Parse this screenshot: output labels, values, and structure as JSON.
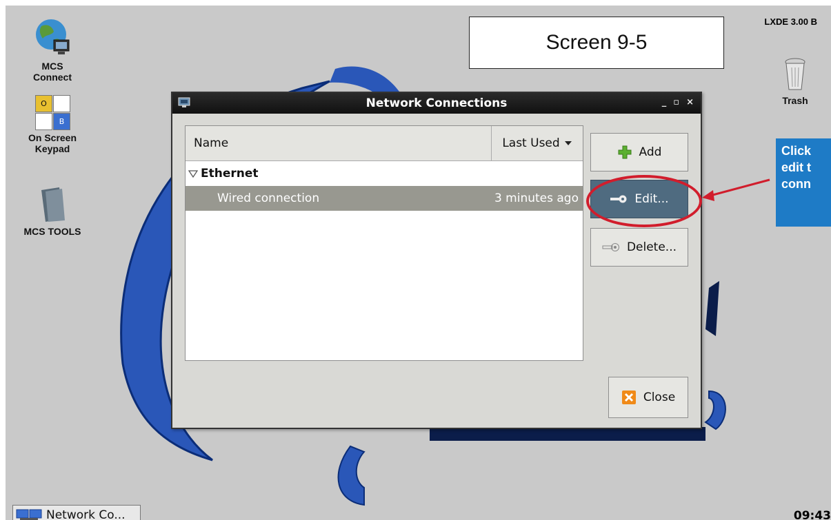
{
  "desktop": {
    "version": "LXDE 3.00 B",
    "icons": [
      {
        "label_line1": "MCS",
        "label_line2": "Connect"
      },
      {
        "label_line1": "On Screen",
        "label_line2": "Keypad"
      },
      {
        "label_line1": "MCS TOOLS"
      },
      {
        "label_line1": "Trash"
      }
    ],
    "keypad_keys": [
      "O",
      "B"
    ]
  },
  "caption": "Screen 9-5",
  "callout": {
    "lines": [
      "Click",
      "edit t",
      "conn"
    ]
  },
  "window": {
    "title": "Network Connections",
    "controls": {
      "minimize": "_",
      "maximize": "▫",
      "close": "×"
    },
    "columns": {
      "name": "Name",
      "last_used": "Last Used"
    },
    "group": "Ethernet",
    "rows": [
      {
        "name": "Wired connection",
        "last_used": "3 minutes ago"
      }
    ],
    "buttons": {
      "add": "Add",
      "edit": "Edit...",
      "delete": "Delete...",
      "close": "Close"
    }
  },
  "taskbar": {
    "item": "Network Co...",
    "clock": "09:43"
  },
  "colors": {
    "accent_blue": "#1e7bc6",
    "highlight_red": "#d11d2c",
    "selected_row": "#989890"
  }
}
